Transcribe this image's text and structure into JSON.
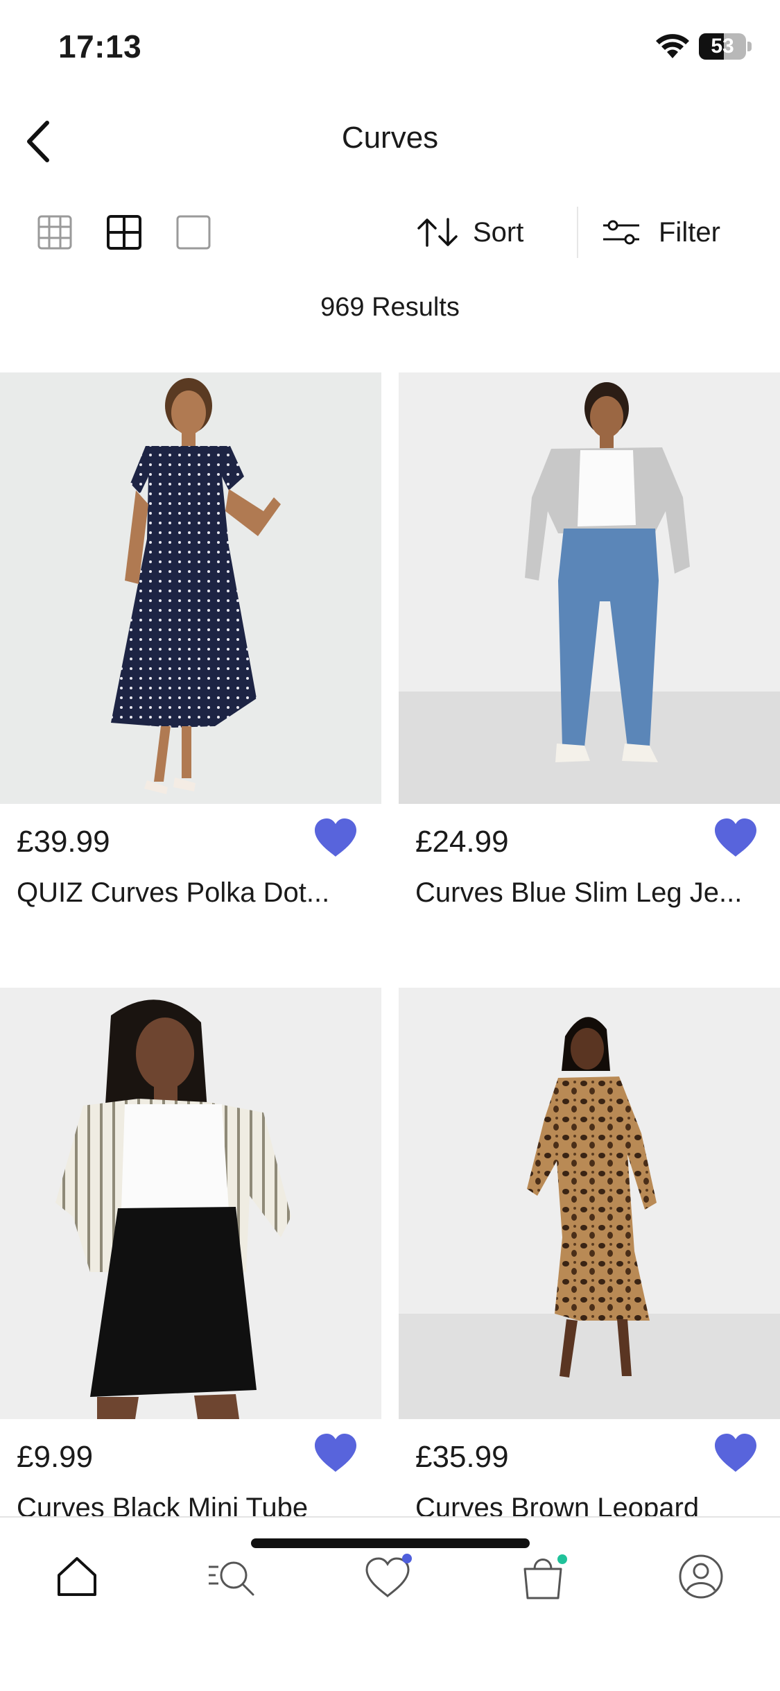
{
  "status_bar": {
    "time": "17:13",
    "battery_level": "53",
    "battery_fraction": 0.53
  },
  "header": {
    "title": "Curves"
  },
  "toolbar": {
    "sort_label": "Sort",
    "filter_label": "Filter"
  },
  "results": {
    "text": "969 Results"
  },
  "products": [
    {
      "price": "£39.99",
      "name": "QUIZ Curves Polka Dot...",
      "favorited": true
    },
    {
      "price": "£24.99",
      "name": "Curves Blue Slim Leg Je...",
      "favorited": true
    },
    {
      "price": "£9.99",
      "name": "Curves Black Mini Tube",
      "favorited": true
    },
    {
      "price": "£35.99",
      "name": "Curves Brown Leopard",
      "favorited": true
    }
  ],
  "tab_bar": {
    "items": [
      {
        "icon": "home-icon",
        "active": true
      },
      {
        "icon": "search-icon",
        "active": false
      },
      {
        "icon": "heart-icon",
        "badge_color": "#4f5fdc"
      },
      {
        "icon": "bag-icon",
        "badge_color": "#20c29a"
      },
      {
        "icon": "profile-icon",
        "active": false
      }
    ]
  },
  "colors": {
    "accent": "#5864dc",
    "text": "#1a1a1a",
    "divider": "#e6e6e6"
  }
}
